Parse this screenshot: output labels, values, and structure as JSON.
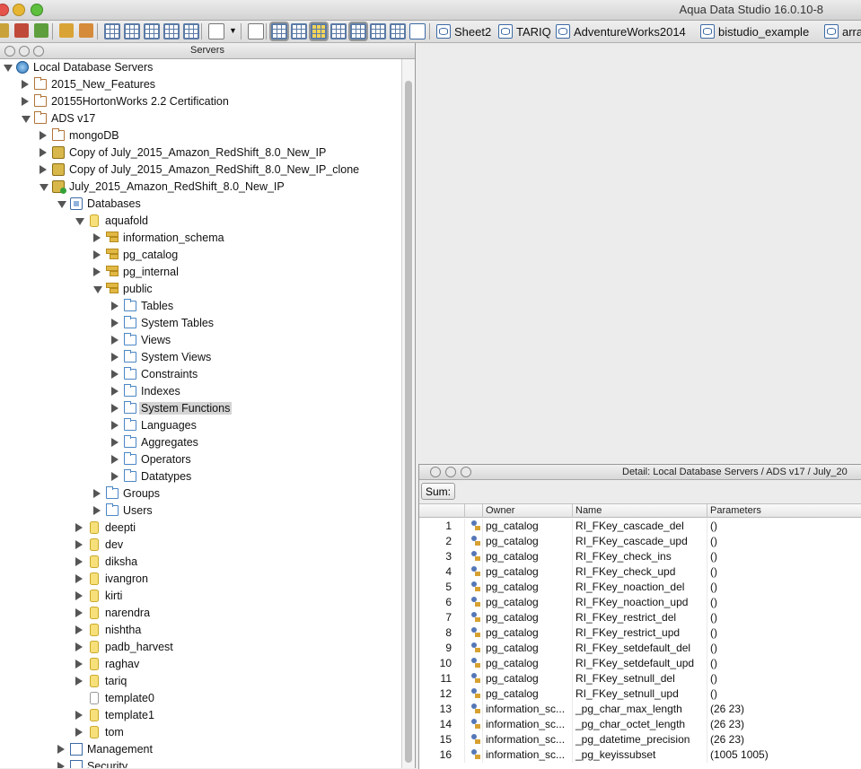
{
  "window": {
    "title": "Aqua Data Studio 16.0.10-8"
  },
  "connection_tabs": [
    "Sheet2",
    "TARIQ",
    "AdventureWorks2014",
    "bistudio_example",
    "arra"
  ],
  "server_panel": {
    "title": "Servers"
  },
  "tree": [
    {
      "label": "Local Database Servers",
      "level": 0,
      "toggle": "down",
      "icon": "globe"
    },
    {
      "label": "2015_New_Features",
      "level": 1,
      "toggle": "right",
      "icon": "folder"
    },
    {
      "label": "20155HortonWorks 2.2 Certification",
      "level": 1,
      "toggle": "right",
      "icon": "folder"
    },
    {
      "label": "ADS v17",
      "level": 1,
      "toggle": "down",
      "icon": "folder"
    },
    {
      "label": "mongoDB",
      "level": 2,
      "toggle": "right",
      "icon": "folder"
    },
    {
      "label": "Copy of July_2015_Amazon_RedShift_8.0_New_IP",
      "level": 2,
      "toggle": "right",
      "icon": "server"
    },
    {
      "label": "Copy of July_2015_Amazon_RedShift_8.0_New_IP_clone",
      "level": 2,
      "toggle": "right",
      "icon": "server"
    },
    {
      "label": "July_2015_Amazon_RedShift_8.0_New_IP",
      "level": 2,
      "toggle": "down",
      "icon": "server-green"
    },
    {
      "label": "Databases",
      "level": 3,
      "toggle": "down",
      "icon": "databases"
    },
    {
      "label": "aquafold",
      "level": 4,
      "toggle": "down",
      "icon": "dbcyl"
    },
    {
      "label": "information_schema",
      "level": 5,
      "toggle": "right",
      "icon": "schema"
    },
    {
      "label": "pg_catalog",
      "level": 5,
      "toggle": "right",
      "icon": "schema"
    },
    {
      "label": "pg_internal",
      "level": 5,
      "toggle": "right",
      "icon": "schema"
    },
    {
      "label": "public",
      "level": 5,
      "toggle": "down",
      "icon": "schema"
    },
    {
      "label": "Tables",
      "level": 6,
      "toggle": "right",
      "icon": "bluefolder"
    },
    {
      "label": "System Tables",
      "level": 6,
      "toggle": "right",
      "icon": "bluefolder"
    },
    {
      "label": "Views",
      "level": 6,
      "toggle": "right",
      "icon": "bluefolder"
    },
    {
      "label": "System Views",
      "level": 6,
      "toggle": "right",
      "icon": "bluefolder"
    },
    {
      "label": "Constraints",
      "level": 6,
      "toggle": "right",
      "icon": "bluefolder"
    },
    {
      "label": "Indexes",
      "level": 6,
      "toggle": "right",
      "icon": "bluefolder"
    },
    {
      "label": "System Functions",
      "level": 6,
      "toggle": "right",
      "icon": "bluefolder",
      "selected": true
    },
    {
      "label": "Languages",
      "level": 6,
      "toggle": "right",
      "icon": "bluefolder"
    },
    {
      "label": "Aggregates",
      "level": 6,
      "toggle": "right",
      "icon": "bluefolder"
    },
    {
      "label": "Operators",
      "level": 6,
      "toggle": "right",
      "icon": "bluefolder"
    },
    {
      "label": "Datatypes",
      "level": 6,
      "toggle": "right",
      "icon": "bluefolder"
    },
    {
      "label": "Groups",
      "level": 5,
      "toggle": "right",
      "icon": "bluefolder"
    },
    {
      "label": "Users",
      "level": 5,
      "toggle": "right",
      "icon": "bluefolder"
    },
    {
      "label": "deepti",
      "level": 4,
      "toggle": "right",
      "icon": "dbcyl"
    },
    {
      "label": "dev",
      "level": 4,
      "toggle": "right",
      "icon": "dbcyl"
    },
    {
      "label": "diksha",
      "level": 4,
      "toggle": "right",
      "icon": "dbcyl"
    },
    {
      "label": "ivangron",
      "level": 4,
      "toggle": "right",
      "icon": "dbcyl"
    },
    {
      "label": "kirti",
      "level": 4,
      "toggle": "right",
      "icon": "dbcyl"
    },
    {
      "label": "narendra",
      "level": 4,
      "toggle": "right",
      "icon": "dbcyl"
    },
    {
      "label": "nishtha",
      "level": 4,
      "toggle": "right",
      "icon": "dbcyl"
    },
    {
      "label": "padb_harvest",
      "level": 4,
      "toggle": "right",
      "icon": "dbcyl"
    },
    {
      "label": "raghav",
      "level": 4,
      "toggle": "right",
      "icon": "dbcyl"
    },
    {
      "label": "tariq",
      "level": 4,
      "toggle": "right",
      "icon": "dbcyl"
    },
    {
      "label": "template0",
      "level": 4,
      "toggle": "none",
      "icon": "dbcyl-empty"
    },
    {
      "label": "template1",
      "level": 4,
      "toggle": "right",
      "icon": "dbcyl"
    },
    {
      "label": "tom",
      "level": 4,
      "toggle": "right",
      "icon": "dbcyl"
    },
    {
      "label": "Management",
      "level": 3,
      "toggle": "right",
      "icon": "mgmt"
    },
    {
      "label": "Security",
      "level": 3,
      "toggle": "right",
      "icon": "mgmt"
    }
  ],
  "detail": {
    "title": "Detail: Local Database Servers / ADS v17 / July_20",
    "sum_label": "Sum:",
    "columns": [
      "",
      "",
      "Owner",
      "Name",
      "Parameters"
    ],
    "rows": [
      {
        "num": "1",
        "owner": "pg_catalog",
        "name": "RI_FKey_cascade_del",
        "params": "()"
      },
      {
        "num": "2",
        "owner": "pg_catalog",
        "name": "RI_FKey_cascade_upd",
        "params": "()"
      },
      {
        "num": "3",
        "owner": "pg_catalog",
        "name": "RI_FKey_check_ins",
        "params": "()"
      },
      {
        "num": "4",
        "owner": "pg_catalog",
        "name": "RI_FKey_check_upd",
        "params": "()"
      },
      {
        "num": "5",
        "owner": "pg_catalog",
        "name": "RI_FKey_noaction_del",
        "params": "()"
      },
      {
        "num": "6",
        "owner": "pg_catalog",
        "name": "RI_FKey_noaction_upd",
        "params": "()"
      },
      {
        "num": "7",
        "owner": "pg_catalog",
        "name": "RI_FKey_restrict_del",
        "params": "()"
      },
      {
        "num": "8",
        "owner": "pg_catalog",
        "name": "RI_FKey_restrict_upd",
        "params": "()"
      },
      {
        "num": "9",
        "owner": "pg_catalog",
        "name": "RI_FKey_setdefault_del",
        "params": "()"
      },
      {
        "num": "10",
        "owner": "pg_catalog",
        "name": "RI_FKey_setdefault_upd",
        "params": "()"
      },
      {
        "num": "11",
        "owner": "pg_catalog",
        "name": "RI_FKey_setnull_del",
        "params": "()"
      },
      {
        "num": "12",
        "owner": "pg_catalog",
        "name": "RI_FKey_setnull_upd",
        "params": "()"
      },
      {
        "num": "13",
        "owner": "information_sc...",
        "name": "_pg_char_max_length",
        "params": "(26 23)"
      },
      {
        "num": "14",
        "owner": "information_sc...",
        "name": "_pg_char_octet_length",
        "params": "(26 23)"
      },
      {
        "num": "15",
        "owner": "information_sc...",
        "name": "_pg_datetime_precision",
        "params": "(26 23)"
      },
      {
        "num": "16",
        "owner": "information_sc...",
        "name": "_pg_keyissubset",
        "params": "(1005 1005)"
      }
    ]
  }
}
